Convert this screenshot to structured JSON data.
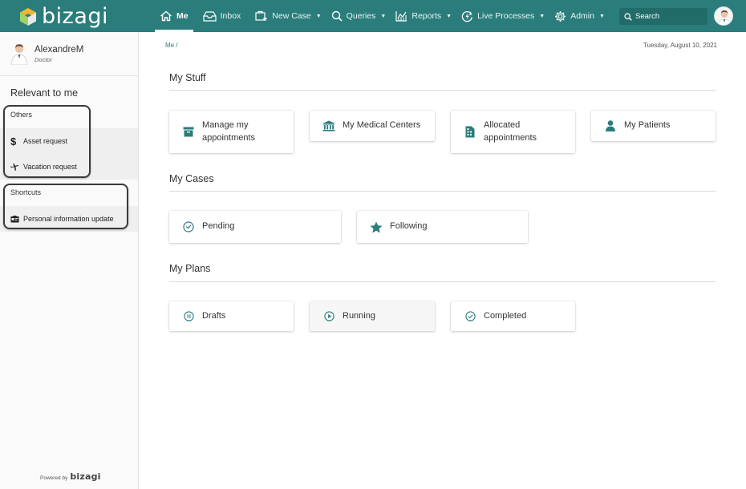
{
  "app": {
    "logo_text": "bizagi"
  },
  "nav": {
    "me": "Me",
    "inbox": "Inbox",
    "new_case": "New Case",
    "queries": "Queries",
    "reports": "Reports",
    "live_processes": "Live Processes",
    "admin": "Admin",
    "caret": "▼"
  },
  "search": {
    "label": "Search"
  },
  "user": {
    "name": "AlexandreM",
    "role": "Doctor"
  },
  "sidebar": {
    "relevant_title": "Relevant to me",
    "others_label": "Others",
    "shortcuts_label": "Shortcuts",
    "asset_icon": "$",
    "asset_request": "Asset request",
    "vacation_request": "Vacation request",
    "personal_info_update": "Personal information update",
    "powered_by": "Powered by",
    "powered_logo": "bizagi"
  },
  "breadcrumb": "Me /",
  "date": "Tuesday, August 10, 2021",
  "sections": {
    "my_stuff": "My Stuff",
    "my_cases": "My Cases",
    "my_plans": "My Plans"
  },
  "cards": {
    "manage_appointments": [
      "Manage my",
      "appointments"
    ],
    "medical_centers": "My Medical Centers",
    "allocated_appointments": [
      "Allocated",
      "appointments"
    ],
    "patients": "My Patients",
    "pending": "Pending",
    "following": "Following",
    "drafts": "Drafts",
    "running": "Running",
    "completed": "Completed"
  },
  "colors": {
    "brand": "#2a7d7b",
    "accent_icon": "#2a7d7b"
  }
}
